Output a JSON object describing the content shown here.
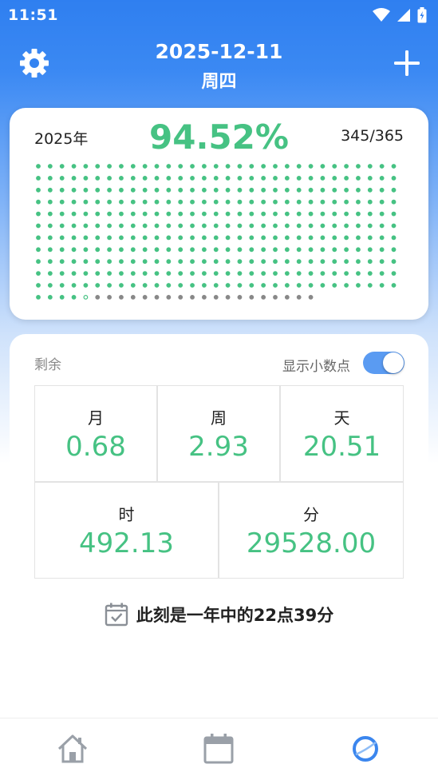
{
  "status_bar": {
    "time": "11:51"
  },
  "header": {
    "date": "2025-12-11",
    "weekday": "周四"
  },
  "progress": {
    "year_label": "2025年",
    "percent_text": "94.52%",
    "day_count_text": "345/365",
    "days_elapsed": 345,
    "days_total": 365,
    "dot_colors": {
      "elapsed": "#46c283",
      "remaining": "#888888"
    }
  },
  "remaining": {
    "label": "剩余",
    "decimal_toggle_label": "显示小数点",
    "decimal_toggle_on": true,
    "items": [
      {
        "unit": "月",
        "value": "0.68"
      },
      {
        "unit": "周",
        "value": "2.93"
      },
      {
        "unit": "天",
        "value": "20.51"
      },
      {
        "unit": "时",
        "value": "492.13"
      },
      {
        "unit": "分",
        "value": "29528.00"
      }
    ]
  },
  "moment_text": "此刻是一年中的22点39分",
  "nav": {
    "items": [
      "home-icon",
      "calendar-icon",
      "circle-icon"
    ]
  },
  "colors": {
    "accent_blue": "#2f7ff0",
    "value_green": "#46c283"
  }
}
